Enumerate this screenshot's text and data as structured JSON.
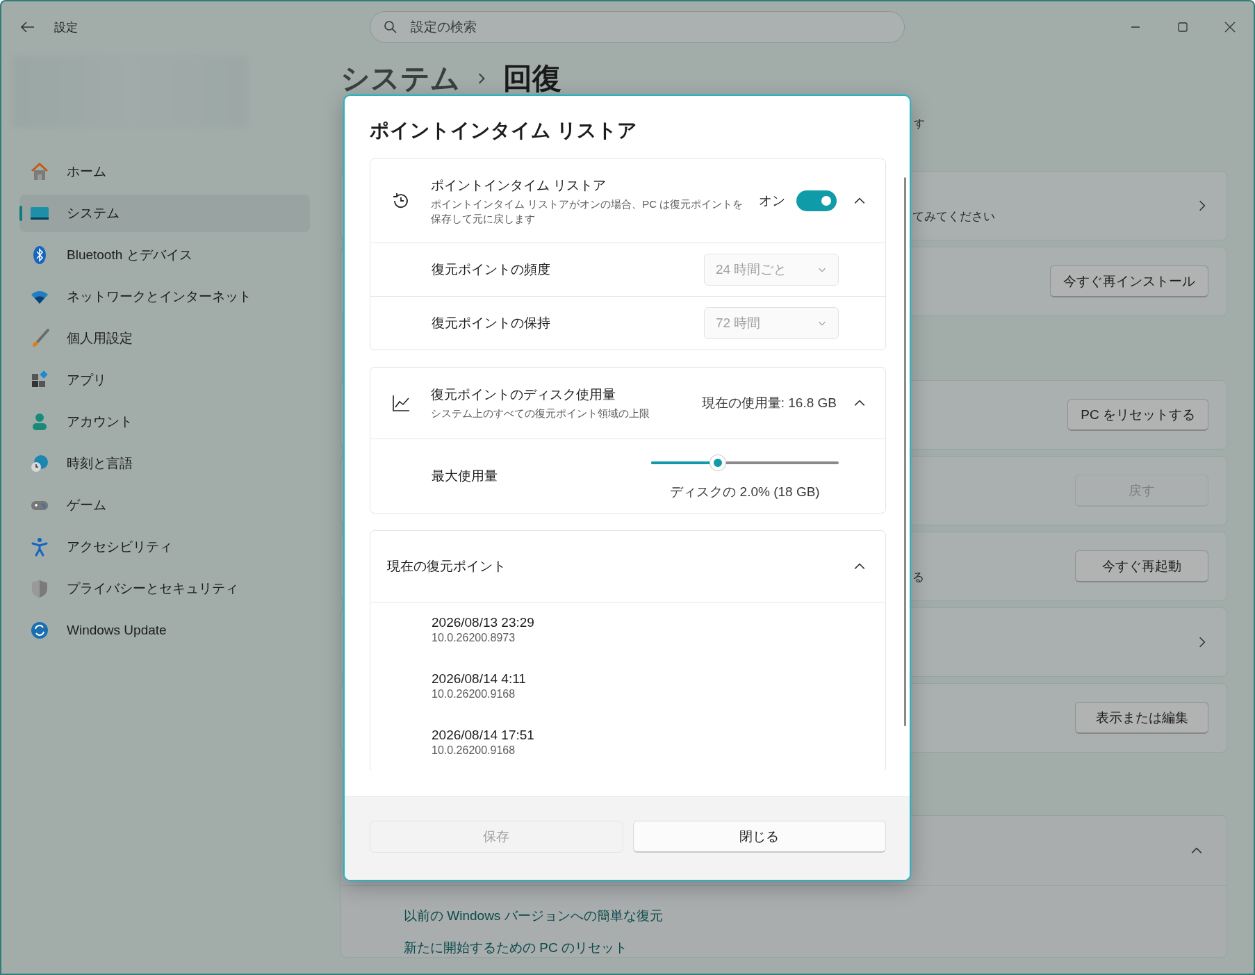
{
  "window": {
    "title": "設定",
    "search": {
      "placeholder": "設定の検索"
    }
  },
  "sidebar": {
    "items": [
      {
        "label": "ホーム",
        "selected": false
      },
      {
        "label": "システム",
        "selected": true
      },
      {
        "label": "Bluetooth とデバイス",
        "selected": false
      },
      {
        "label": "ネットワークとインターネット",
        "selected": false
      },
      {
        "label": "個人用設定",
        "selected": false
      },
      {
        "label": "アプリ",
        "selected": false
      },
      {
        "label": "アカウント",
        "selected": false
      },
      {
        "label": "時刻と言語",
        "selected": false
      },
      {
        "label": "ゲーム",
        "selected": false
      },
      {
        "label": "アクセシビリティ",
        "selected": false
      },
      {
        "label": "プライバシーとセキュリティ",
        "selected": false
      },
      {
        "label": "Windows Update",
        "selected": false
      }
    ]
  },
  "breadcrumb": {
    "parent": "システム",
    "current": "回復"
  },
  "page": {
    "note": "す",
    "card_groups": [
      [
        {
          "kind": "chevron",
          "text": "てみてください"
        },
        {
          "kind": "button",
          "button": "今すぐ再インストール",
          "disabled": false
        }
      ],
      [
        {
          "kind": "button",
          "button": "PC をリセットする",
          "disabled": false
        },
        {
          "kind": "button",
          "button": "戻す",
          "disabled": true
        },
        {
          "kind": "button",
          "text": "る",
          "button": "今すぐ再起動",
          "disabled": false
        },
        {
          "kind": "chevron"
        },
        {
          "kind": "button",
          "button": "表示または編集",
          "disabled": false
        }
      ]
    ],
    "help": {
      "expanded": true,
      "links": [
        "以前の Windows バージョンへの簡単な復元",
        "新たに開始するための PC のリセット"
      ]
    }
  },
  "dialog": {
    "title": "ポイントインタイム リストア",
    "restore_card": {
      "title": "ポイントインタイム リストア",
      "description": "ポイントインタイム リストアがオンの場合、PC は復元ポイントを保存して元に戻します",
      "toggle_label": "オン",
      "on": true,
      "expanded": true,
      "settings": [
        {
          "label": "復元ポイントの頻度",
          "value": "24 時間ごと",
          "disabled": true
        },
        {
          "label": "復元ポイントの保持",
          "value": "72 時間",
          "disabled": true
        }
      ]
    },
    "disk_card": {
      "title": "復元ポイントのディスク使用量",
      "description": "システム上のすべての復元ポイント領域の上限",
      "usage": "現在の使用量: 16.8 GB",
      "expanded": true,
      "slider": {
        "label": "最大使用量",
        "level": 0.355,
        "caption": "ディスクの 2.0% (18 GB)"
      }
    },
    "points_card": {
      "title": "現在の復元ポイント",
      "expanded": true,
      "points": [
        {
          "date": "2026/08/13 23:29",
          "version": "10.0.26200.8973"
        },
        {
          "date": "2026/08/14 4:11",
          "version": "10.0.26200.9168"
        },
        {
          "date": "2026/08/14 17:51",
          "version": "10.0.26200.9168"
        }
      ]
    },
    "buttons": [
      {
        "label": "保存",
        "disabled": true
      },
      {
        "label": "閉じる",
        "disabled": false
      }
    ]
  }
}
